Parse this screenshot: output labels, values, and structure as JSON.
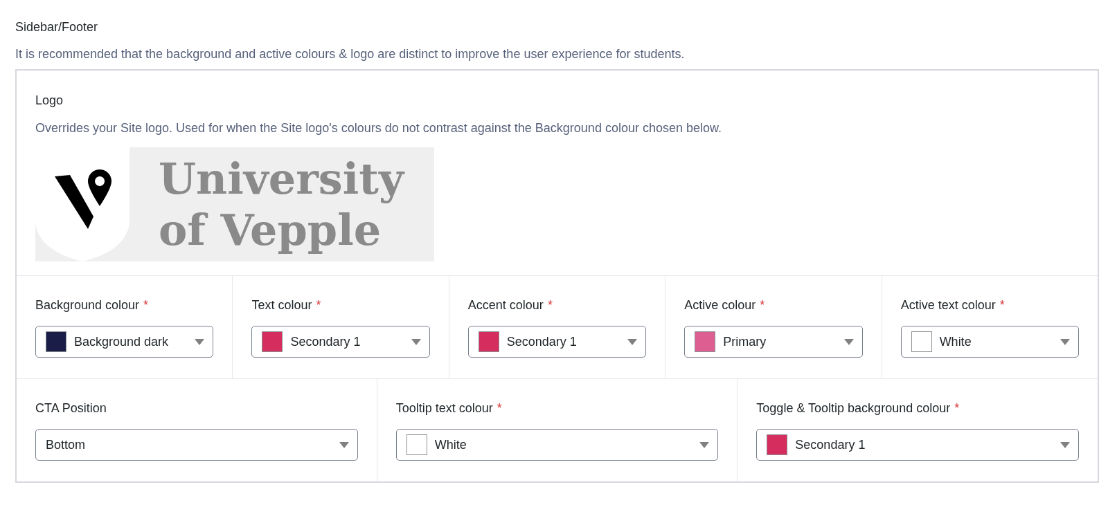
{
  "section": {
    "title": "Sidebar/Footer",
    "description": "It is recommended that the background and active colours & logo are distinct to improve the user experience for students."
  },
  "logo": {
    "label": "Logo",
    "description": "Overrides your Site logo. Used for when the Site logo's colours do not contrast against the Background colour chosen below.",
    "text_lines": [
      "University",
      "of Vepple"
    ]
  },
  "field_rows": [
    [
      {
        "kind": "colour-select",
        "label": "Background colour",
        "required_mark": "*",
        "value": "Background dark",
        "color": "#1a1d47"
      },
      {
        "kind": "colour-select",
        "label": "Text colour",
        "required_mark": "*",
        "value": "Secondary 1",
        "color": "#d42d5e"
      },
      {
        "kind": "colour-select",
        "label": "Accent colour",
        "required_mark": "*",
        "value": "Secondary 1",
        "color": "#d42d5e"
      },
      {
        "kind": "colour-select",
        "label": "Active colour",
        "required_mark": "*",
        "value": "Primary",
        "color": "#dd5f91"
      },
      {
        "kind": "colour-select",
        "label": "Active text colour",
        "required_mark": "*",
        "value": "White",
        "color": "#ffffff"
      }
    ],
    [
      {
        "kind": "select",
        "label": "CTA Position",
        "value": "Bottom"
      },
      {
        "kind": "colour-select",
        "label": "Tooltip text colour",
        "required_mark": "*",
        "value": "White",
        "color": "#ffffff"
      },
      {
        "kind": "colour-select",
        "label": "Toggle & Tooltip background colour",
        "required_mark": "*",
        "value": "Secondary 1",
        "color": "#d42d5e"
      }
    ]
  ]
}
